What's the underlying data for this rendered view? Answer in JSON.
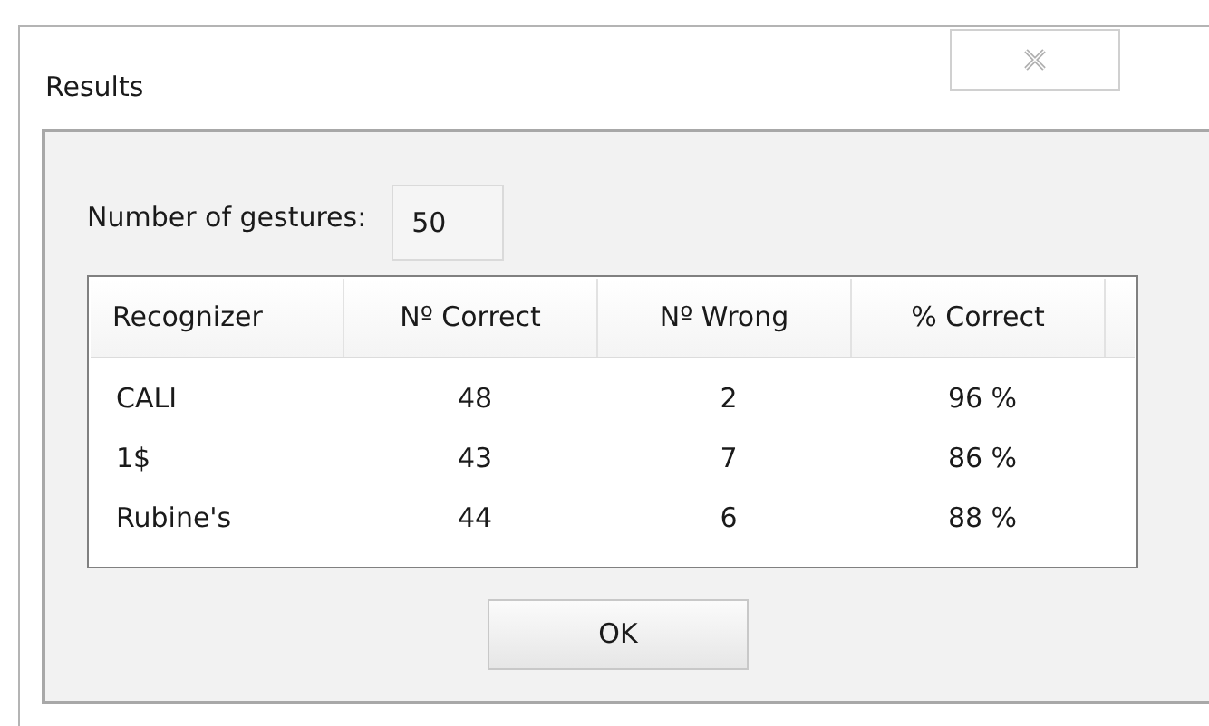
{
  "window": {
    "title": "Results"
  },
  "gestures": {
    "label": "Number of gestures:",
    "value": "50"
  },
  "table": {
    "columns": [
      "Recognizer",
      "Nº Correct",
      "Nº Wrong",
      "% Correct"
    ],
    "rows": [
      [
        "CALI",
        "48",
        "2",
        "96 %"
      ],
      [
        "1$",
        "43",
        "7",
        "86 %"
      ],
      [
        "Rubine's",
        "44",
        "6",
        "88 %"
      ]
    ]
  },
  "buttons": [
    "OK"
  ]
}
